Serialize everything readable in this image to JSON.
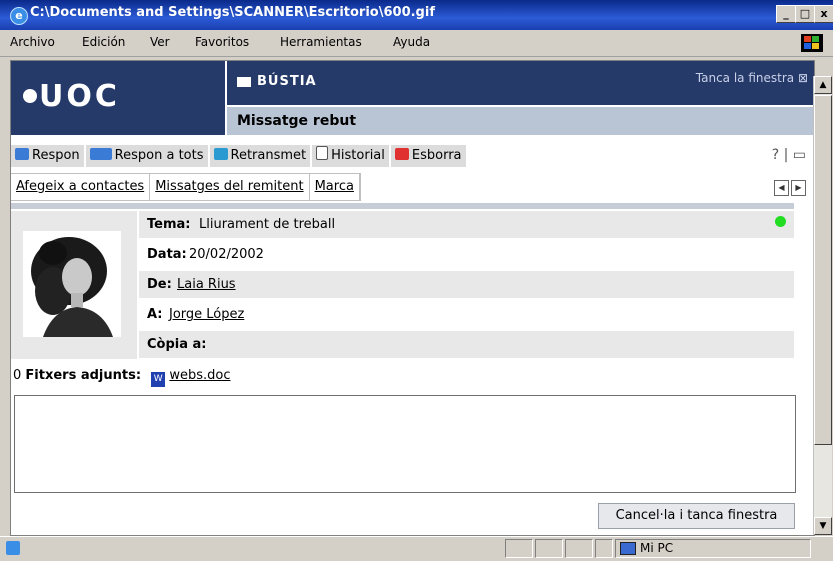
{
  "window": {
    "title": "C:\\Documents and Settings\\SCANNER\\Escritorio\\600.gif",
    "min": "_",
    "max": "□",
    "close": "x"
  },
  "menu": {
    "items": [
      "Archivo",
      "Edición",
      "Ver",
      "Favoritos",
      "Herramientas",
      "Ayuda"
    ]
  },
  "header": {
    "logo": "UOC",
    "section": "BÚSTIA",
    "close_link": "Tanca la finestra ⊠",
    "subtitle": "Missatge rebut"
  },
  "toolbar": {
    "reply": "Respon",
    "reply_all": "Respon a tots",
    "forward": "Retransmet",
    "history": "Historial",
    "delete": "Esborra"
  },
  "actions": {
    "add_contacts": "Afegeix a contactes",
    "sender_messages": "Missatges del remitent",
    "mark": "Marca"
  },
  "message": {
    "subject_label": "Tema:",
    "subject": "Lliurament de treball",
    "date_label": "Data:",
    "date": "20/02/2002",
    "from_label": "De:",
    "from": "Laia Rius",
    "to_label": "A:",
    "to": "Jorge López",
    "cc_label": "Còpia a:",
    "cc": ""
  },
  "attachments": {
    "label": "Fitxers adjunts:",
    "file": "webs.doc"
  },
  "footer": {
    "cancel_button": "Cancel·la i tanca finestra"
  },
  "statusbar": {
    "zone": "Mi PC"
  }
}
